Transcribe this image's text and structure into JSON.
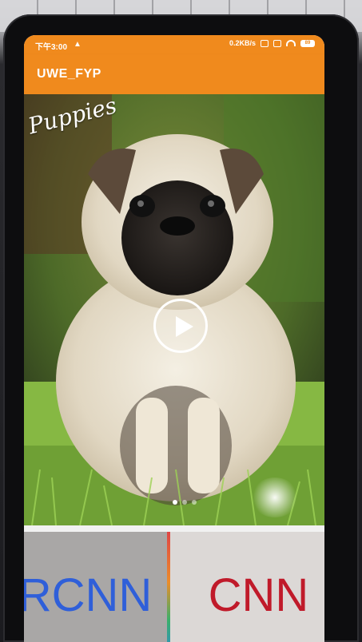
{
  "status_bar": {
    "time": "下午3:00",
    "warning_icon": "warning-icon",
    "net_speed": "0.2KB/s",
    "icons": [
      "vibrate-icon",
      "sim-icon",
      "wifi-icon",
      "battery-icon"
    ],
    "battery": "89"
  },
  "app_bar": {
    "title": "UWE_FYP",
    "color": "#f08a1d"
  },
  "media": {
    "overlay_caption": "Puppies",
    "play_icon": "play-icon",
    "carousel": {
      "count": 3,
      "active": 0
    }
  },
  "buttons": {
    "rcnn_label": "RCNN",
    "rcnn_color": "#2f5fd9",
    "cnn_label": "CNN",
    "cnn_color": "#c01a2a"
  }
}
